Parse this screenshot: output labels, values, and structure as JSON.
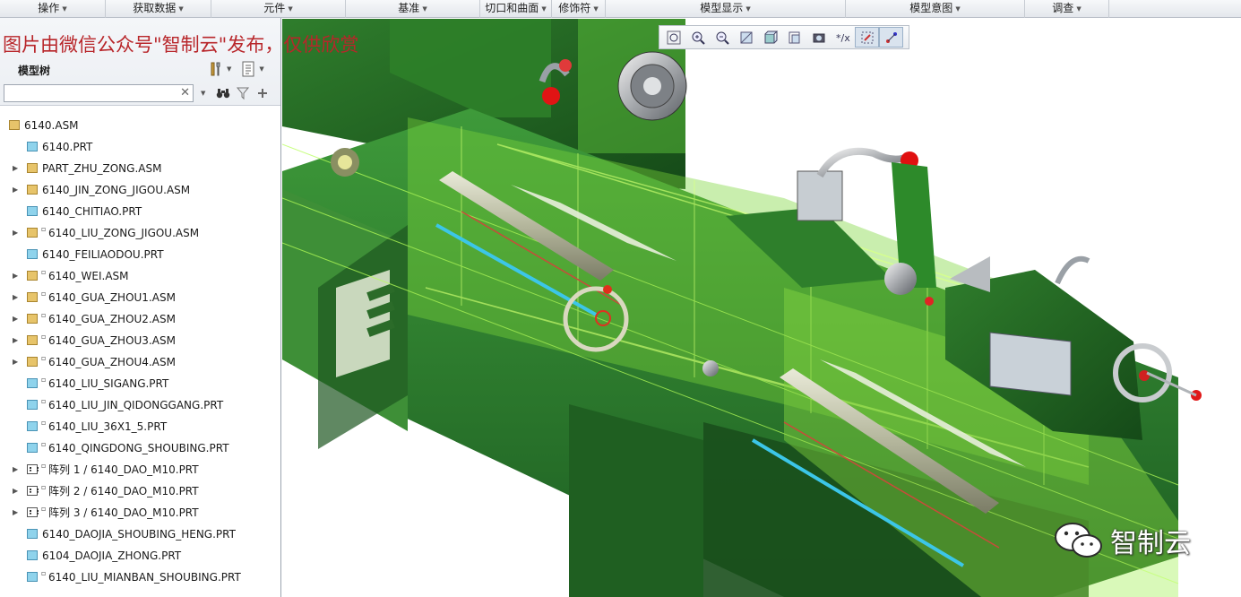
{
  "ribbon": {
    "groups": [
      "操作",
      "获取数据",
      "元件",
      "基准",
      "切口和曲面",
      "修饰符",
      "模型显示",
      "模型意图",
      "调查"
    ]
  },
  "watermark": "图片由微信公众号\"智制云\"发布，仅供欣赏",
  "model_tree": {
    "title": "模型树",
    "search_value": "",
    "tools": [
      "show-tool-icon",
      "settings-icon",
      "find-icon",
      "filter-icon",
      "add-icon"
    ],
    "items": [
      {
        "label": "6140.ASM",
        "type": "asm",
        "expandable": false,
        "level": 0,
        "linked": false
      },
      {
        "label": "6140.PRT",
        "type": "prt",
        "expandable": false,
        "level": 1,
        "linked": false
      },
      {
        "label": "PART_ZHU_ZONG.ASM",
        "type": "asm",
        "expandable": true,
        "level": 1,
        "linked": false
      },
      {
        "label": "6140_JIN_ZONG_JIGOU.ASM",
        "type": "asm",
        "expandable": true,
        "level": 1,
        "linked": false
      },
      {
        "label": "6140_CHITIAO.PRT",
        "type": "prt",
        "expandable": false,
        "level": 1,
        "linked": false
      },
      {
        "label": "6140_LIU_ZONG_JIGOU.ASM",
        "type": "asm",
        "expandable": true,
        "level": 1,
        "linked": true
      },
      {
        "label": "6140_FEILIAODOU.PRT",
        "type": "prt",
        "expandable": false,
        "level": 1,
        "linked": false
      },
      {
        "label": "6140_WEI.ASM",
        "type": "asm",
        "expandable": true,
        "level": 1,
        "linked": true
      },
      {
        "label": "6140_GUA_ZHOU1.ASM",
        "type": "asm",
        "expandable": true,
        "level": 1,
        "linked": true
      },
      {
        "label": "6140_GUA_ZHOU2.ASM",
        "type": "asm",
        "expandable": true,
        "level": 1,
        "linked": true
      },
      {
        "label": "6140_GUA_ZHOU3.ASM",
        "type": "asm",
        "expandable": true,
        "level": 1,
        "linked": true
      },
      {
        "label": "6140_GUA_ZHOU4.ASM",
        "type": "asm",
        "expandable": true,
        "level": 1,
        "linked": true
      },
      {
        "label": "6140_LIU_SIGANG.PRT",
        "type": "prt",
        "expandable": false,
        "level": 1,
        "linked": true
      },
      {
        "label": "6140_LIU_JIN_QIDONGGANG.PRT",
        "type": "prt",
        "expandable": false,
        "level": 1,
        "linked": true
      },
      {
        "label": "6140_LIU_36X1_5.PRT",
        "type": "prt",
        "expandable": false,
        "level": 1,
        "linked": true
      },
      {
        "label": "6140_QINGDONG_SHOUBING.PRT",
        "type": "prt",
        "expandable": false,
        "level": 1,
        "linked": true
      },
      {
        "label": "阵列 1 / 6140_DAO_M10.PRT",
        "type": "pat",
        "expandable": true,
        "level": 1,
        "linked": true
      },
      {
        "label": "阵列 2 / 6140_DAO_M10.PRT",
        "type": "pat",
        "expandable": true,
        "level": 1,
        "linked": true
      },
      {
        "label": "阵列 3 / 6140_DAO_M10.PRT",
        "type": "pat",
        "expandable": true,
        "level": 1,
        "linked": true
      },
      {
        "label": "6140_DAOJIA_SHOUBING_HENG.PRT",
        "type": "prt",
        "expandable": false,
        "level": 1,
        "linked": false
      },
      {
        "label": "6104_DAOJIA_ZHONG.PRT",
        "type": "prt",
        "expandable": false,
        "level": 1,
        "linked": false
      },
      {
        "label": "6140_LIU_MIANBAN_SHOUBING.PRT",
        "type": "prt",
        "expandable": false,
        "level": 1,
        "linked": true
      }
    ]
  },
  "view_toolbar": {
    "buttons": [
      "refit-icon",
      "zoom-in-icon",
      "zoom-out-icon",
      "repaint-icon",
      "display-style-icon",
      "saved-views-icon",
      "view-manager-icon",
      "annotation-display-icon",
      "spin-center-icon",
      "datum-display-icon"
    ],
    "active": [
      8,
      9
    ]
  },
  "brand": {
    "text": "智制云",
    "icon": "wechat-icon"
  },
  "colors": {
    "accent_green": "#9ef03c",
    "body_green": "#2f7a2f",
    "watermark_red": "#b8262a"
  }
}
